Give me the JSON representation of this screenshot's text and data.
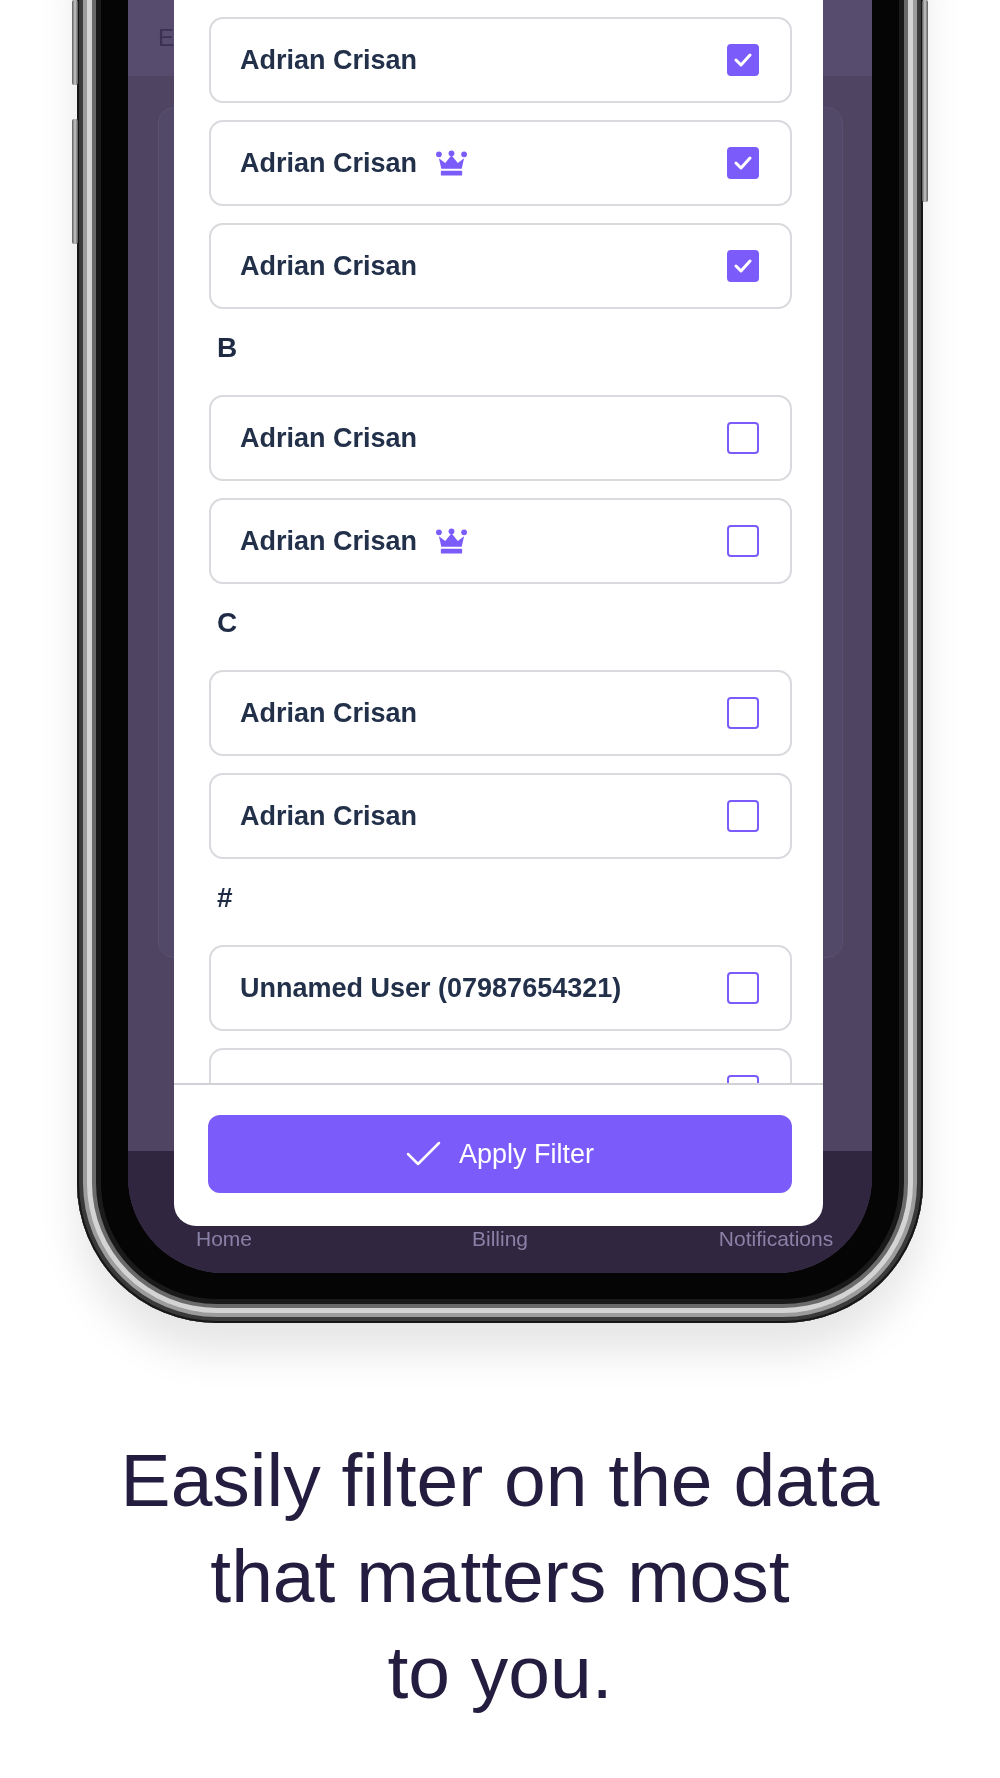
{
  "phone_screen": {
    "header": {
      "title": "E"
    },
    "filter_modal": {
      "sections": [
        {
          "items": [
            {
              "name": "Adrian Crisan",
              "crown": false,
              "checked": true
            },
            {
              "name": "Adrian Crisan",
              "crown": true,
              "checked": true
            },
            {
              "name": "Adrian Crisan",
              "crown": false,
              "checked": true
            }
          ]
        },
        {
          "heading": "B",
          "items": [
            {
              "name": "Adrian Crisan",
              "crown": false,
              "checked": false
            },
            {
              "name": "Adrian Crisan",
              "crown": true,
              "checked": false
            }
          ]
        },
        {
          "heading": "C",
          "items": [
            {
              "name": "Adrian Crisan",
              "crown": false,
              "checked": false
            },
            {
              "name": "Adrian Crisan",
              "crown": false,
              "checked": false
            }
          ]
        },
        {
          "heading": "#",
          "items": [
            {
              "name": "Unnamed User (07987654321)",
              "crown": false,
              "checked": false
            },
            {
              "checked": false
            }
          ]
        }
      ],
      "apply_button": {
        "label": "Apply Filter"
      }
    },
    "bottom_nav": {
      "tabs": [
        "Home",
        "Billing",
        "Notifications"
      ]
    }
  },
  "caption": "Easily filter on the data\nthat matters most\nto you."
}
